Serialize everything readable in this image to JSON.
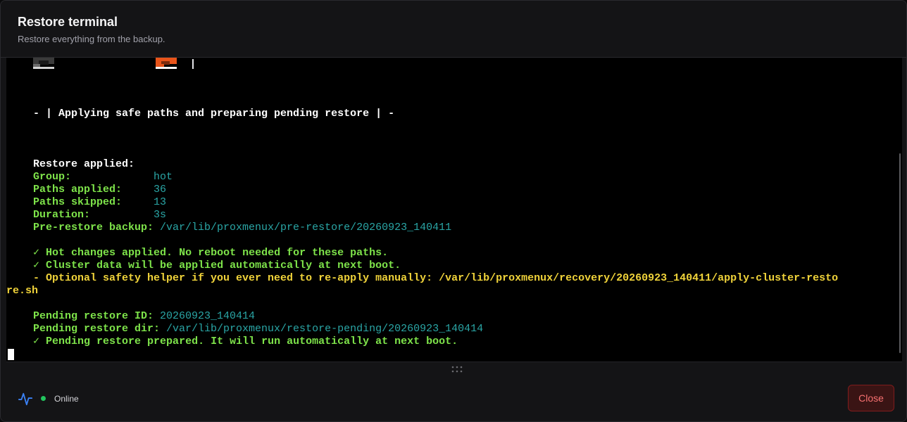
{
  "dialog": {
    "title": "Restore terminal",
    "subtitle": "Restore everything from the backup."
  },
  "terminal": {
    "banner": "- | Applying safe paths and preparing pending restore | -",
    "summary_heading": "Restore applied:",
    "summary": [
      {
        "label": "Group:             ",
        "value": "hot"
      },
      {
        "label": "Paths applied:     ",
        "value": "36"
      },
      {
        "label": "Paths skipped:     ",
        "value": "13"
      },
      {
        "label": "Duration:          ",
        "value": "3s"
      },
      {
        "label": "Pre-restore backup: ",
        "value": "/var/lib/proxmenux/pre-restore/20260923_140411"
      }
    ],
    "messages": [
      "✓ Hot changes applied. No reboot needed for these paths.",
      "✓ Cluster data will be applied automatically at next boot."
    ],
    "optional_helper_line1": "- Optional safety helper if you ever need to re-apply manually: /var/lib/proxmenux/recovery/20260923_140411/apply-cluster-resto",
    "optional_helper_line2": "re.sh",
    "pending": [
      {
        "label": "Pending restore ID: ",
        "value": "20260923_140414"
      },
      {
        "label": "Pending restore dir: ",
        "value": "/var/lib/proxmenux/restore-pending/20260923_140414"
      }
    ],
    "final_message": "✓ Pending restore prepared. It will run automatically at next boot."
  },
  "footer": {
    "status_icon": "activity-icon",
    "status_label": "Online",
    "close_label": "Close"
  },
  "colors": {
    "accent_green": "#7ee34a",
    "value_cyan": "#2aa6a6",
    "warning_yellow": "#f0d33a",
    "status_online": "#22c55e",
    "close_red": "#f87171"
  }
}
